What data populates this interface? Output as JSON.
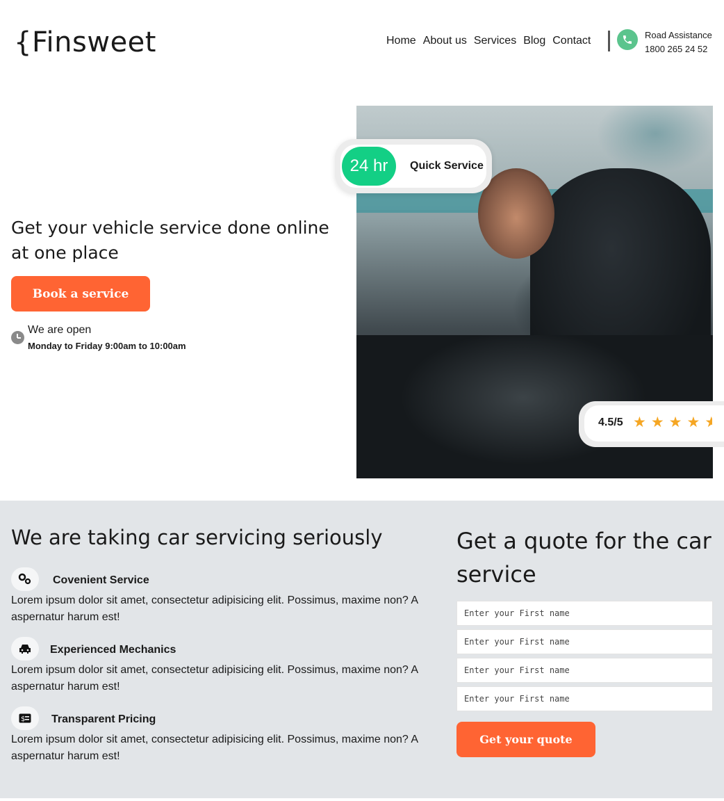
{
  "header": {
    "logo": "{Finsweet",
    "nav": [
      "Home",
      "About us",
      "Services",
      "Blog",
      "Contact"
    ],
    "road_assistance_label": "Road Assistance",
    "road_assistance_phone": "1800 265 24 52"
  },
  "hero": {
    "title": "Get your vehicle service done online at one place",
    "book_button": "Book a service",
    "open_label": "We are open",
    "open_hours": "Monday to Friday 9:00am to 10:00am",
    "quick_badge_time": "24 hr",
    "quick_badge_label": "Quick Service",
    "rating": "4.5/5",
    "rating_stars": 4.5
  },
  "features": {
    "section_title": "We are taking car servicing seriously",
    "items": [
      {
        "icon": "gears-icon",
        "title": "Covenient Service",
        "description": "Lorem ipsum dolor sit amet, consectetur adipisicing elit. Possimus, maxime non? A aspernatur harum est!"
      },
      {
        "icon": "car-icon",
        "title": "Experienced Mechanics",
        "description": "Lorem ipsum dolor sit amet, consectetur adipisicing elit. Possimus, maxime non? A aspernatur harum est!"
      },
      {
        "icon": "money-icon",
        "title": "Transparent Pricing",
        "description": "Lorem ipsum dolor sit amet, consectetur adipisicing elit. Possimus, maxime non? A aspernatur harum est!"
      }
    ]
  },
  "quote": {
    "title": "Get a quote for the car service",
    "inputs": [
      {
        "placeholder": "Enter your First name"
      },
      {
        "placeholder": "Enter your First name"
      },
      {
        "placeholder": "Enter your First name"
      },
      {
        "placeholder": "Enter your First name"
      }
    ],
    "submit_button": "Get your quote"
  },
  "colors": {
    "accent": "#ff6433",
    "green": "#13cf85",
    "phone_green": "#5bc48d",
    "star": "#f5a623",
    "section_bg": "#e2e5e8"
  }
}
